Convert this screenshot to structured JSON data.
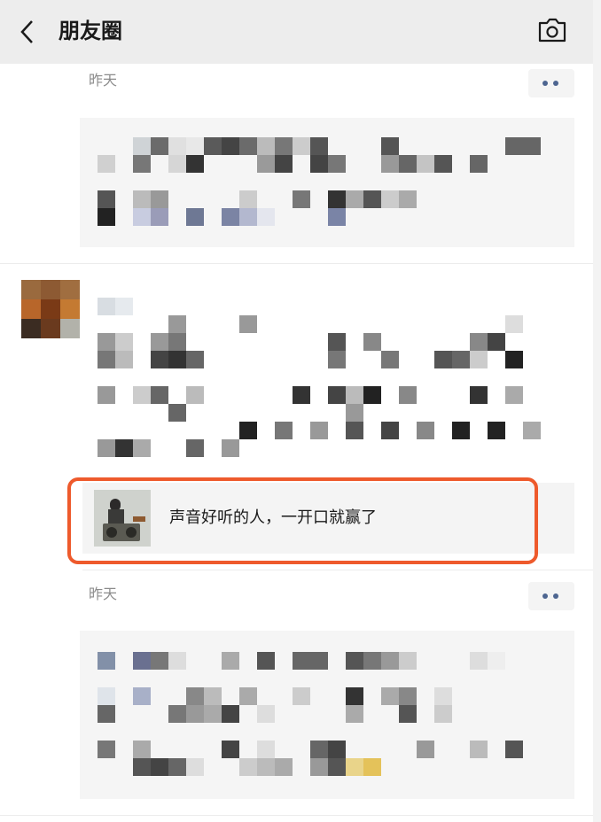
{
  "header": {
    "title": "朋友圈",
    "back_icon": "chevron-left-icon",
    "camera_icon": "camera-icon"
  },
  "posts": [
    {
      "time": "昨天",
      "more_icon": "more-dots-icon"
    },
    {
      "shared_link_title": "声音好听的人，一开口就赢了",
      "thumb_icon": "music-cover-icon"
    },
    {
      "time": "昨天",
      "more_icon": "more-dots-icon"
    }
  ],
  "colors": {
    "header_bg": "#ededed",
    "highlight": "#ee5a2c",
    "link_blue": "#4d6590"
  }
}
